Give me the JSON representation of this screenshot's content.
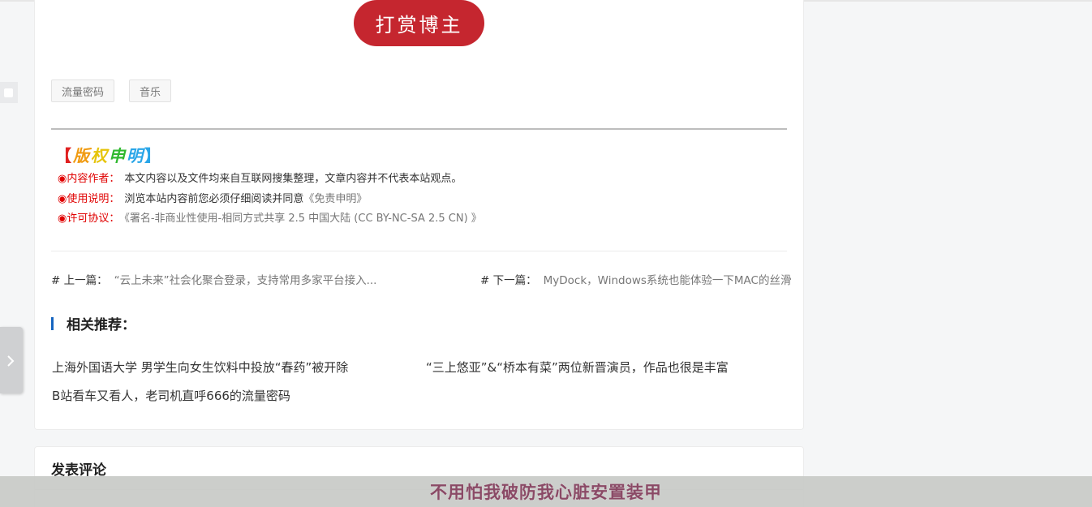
{
  "article": {
    "reward_button": "打赏博主",
    "tags": [
      "流量密码",
      "音乐"
    ],
    "copyright": {
      "title_chars": [
        "【",
        "版",
        "权",
        "申",
        "明",
        "】"
      ],
      "lines": [
        {
          "label": "◉内容作者：",
          "text": "本文内容以及文件均来自互联网搜集整理，文章内容并不代表本站观点。",
          "link": ""
        },
        {
          "label": "◉使用说明：",
          "text": "浏览本站内容前您必须仔细阅读并同意",
          "link": "《免责申明》"
        },
        {
          "label": "◉许可协议：",
          "text": "",
          "link": "《署名-非商业性使用-相同方式共享 2.5 中国大陆 (CC BY-NC-SA 2.5 CN) 》"
        }
      ]
    },
    "nav": {
      "prev_label": "# 上一篇：",
      "prev_title": "“云上未来”社会化聚合登录，支持常用多家平台接入...",
      "next_label": "# 下一篇：",
      "next_title": "MyDock，Windows系统也能体验一下MAC的丝滑"
    },
    "related": {
      "title": "相关推荐：",
      "items": [
        "上海外国语大学 男学生向女生饮料中投放“春药”被开除",
        "“三上悠亚”&“桥本有菜”两位新晋演员，作品也很是丰富",
        "B站看车又看人，老司机直呼666的流量密码"
      ]
    }
  },
  "comment": {
    "title": "发表评论"
  },
  "lyric": {
    "text": "不用怕我破防我心脏安置装甲"
  },
  "icons": {
    "side_tab": "chevron-right-icon",
    "left_square": "square-icon"
  },
  "colors": {
    "reward": "#c5262f",
    "label_red": "#e00000",
    "accent_blue": "#1565c0",
    "lyric": "#8a4a66"
  }
}
